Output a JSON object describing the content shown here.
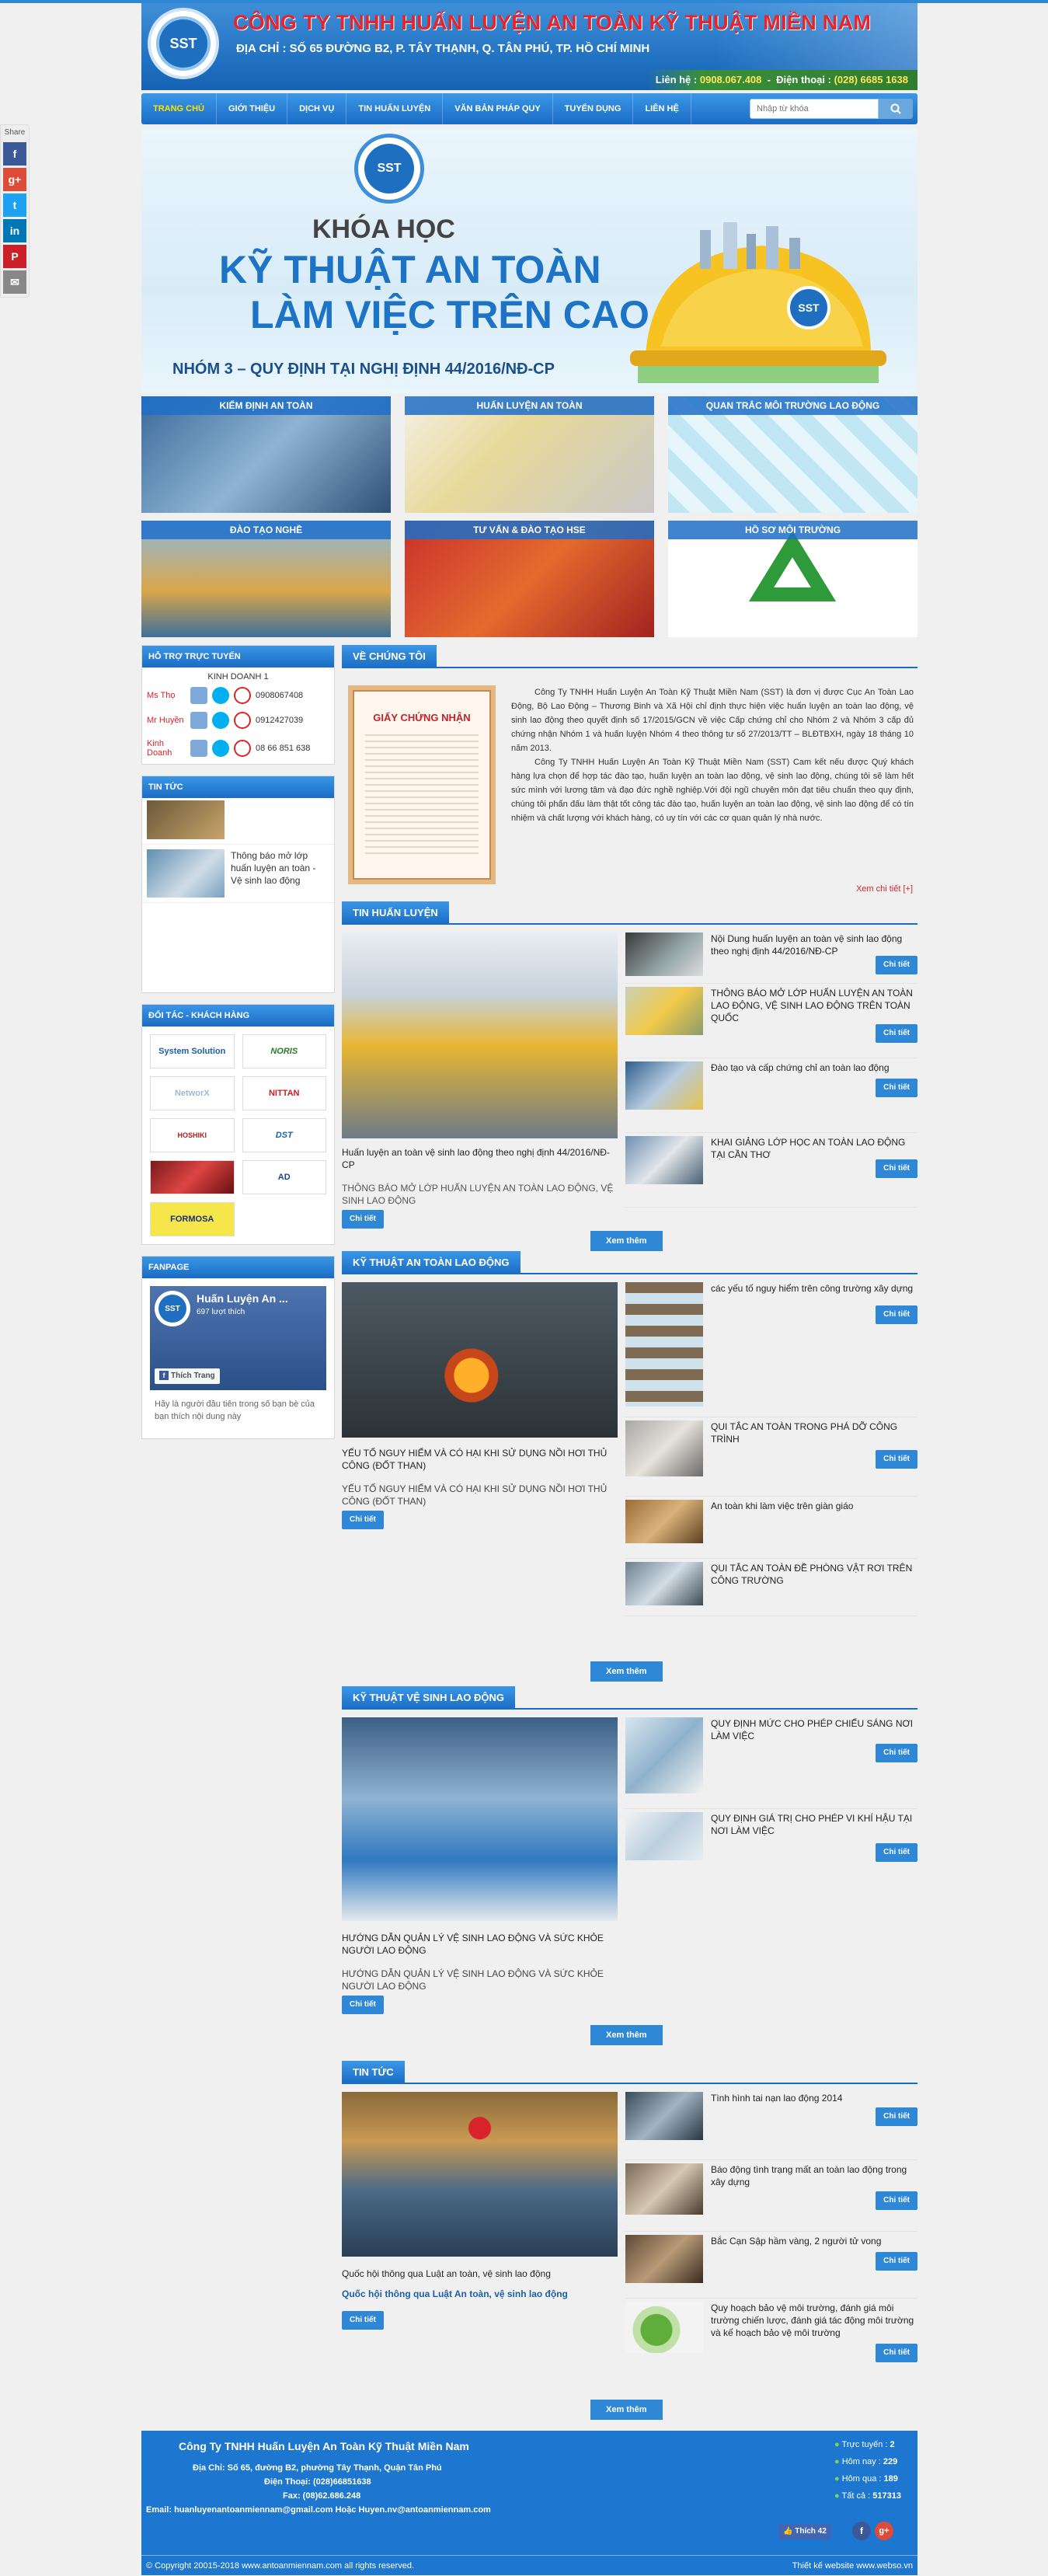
{
  "header": {
    "company": "CÔNG TY TNHH HUẤN LUYỆN AN TOÀN KỸ THUẬT MIỀN NAM",
    "address": "ĐỊA CHỈ : SỐ 65 ĐƯỜNG B2, P. TÂY THẠNH, Q. TÂN PHÚ, TP. HỒ CHÍ MINH",
    "contact_label": "Liên hệ :",
    "contact_phone": "0908.067.408",
    "hotline_label": "Điện thoại :",
    "hotline_phone": "(028) 6685 1638",
    "logo_text": "SST"
  },
  "nav": {
    "items": [
      "TRANG CHỦ",
      "GIỚI THIỆU",
      "DỊCH VỤ",
      "TIN HUẤN LUYỆN",
      "VĂN BẢN PHÁP QUY",
      "TUYỂN DỤNG",
      "LIÊN HỆ"
    ],
    "search_placeholder": "Nhập từ khóa"
  },
  "banner": {
    "logo_text": "SST",
    "line1": "KHÓA HỌC",
    "line2": "KỸ THUẬT AN TOÀN",
    "line3": "LÀM VIỆC TRÊN CAO",
    "line4": "NHÓM 3 – QUY ĐỊNH TẠI NGHỊ ĐỊNH 44/2016/NĐ-CP"
  },
  "tiles": [
    {
      "label": "KIỂM ĐỊNH AN TOÀN"
    },
    {
      "label": "HUẤN LUYỆN AN TOÀN"
    },
    {
      "label": "QUAN TRẮC MÔI TRƯỜNG LAO ĐỘNG"
    },
    {
      "label": "ĐÀO TẠO NGHỀ"
    },
    {
      "label": "TƯ VẤN & ĐÀO TẠO HSE"
    },
    {
      "label": "HỒ SƠ MÔI TRƯỜNG"
    }
  ],
  "support": {
    "title": "HỖ TRỢ TRỰC TUYẾN",
    "group": "KINH DOANH 1",
    "people": [
      {
        "name": "Ms Thọ",
        "phone": "0908067408"
      },
      {
        "name": "Mr Huyền",
        "phone": "0912427039"
      },
      {
        "name": "Kinh Doanh",
        "phone": "08 66 851 638"
      }
    ]
  },
  "left_news": {
    "title": "TIN TỨC",
    "items": [
      "Thông báo mở lớp huấn luyện an toàn - Vệ sinh lao động"
    ]
  },
  "partners": {
    "title": "ĐỐI TÁC - KHÁCH HÀNG",
    "logos": [
      "System Solution",
      "NORIS",
      "NetworX",
      "NITTAN",
      "HOSHIKI",
      "DST",
      "",
      "AD",
      "FORMOSA"
    ]
  },
  "fanpage": {
    "title": "FANPAGE",
    "page_name": "Huấn Luyện An ...",
    "likes": "697 lượt thích",
    "like_btn": "Thích Trang",
    "note": "Hãy là người đầu tiên trong số bạn bè của bạn thích nội dung này"
  },
  "about": {
    "title": "VỀ CHÚNG TÔI",
    "cert_title": "GIẤY CHỨNG NHẬN",
    "p1": "Công Ty TNHH Huấn Luyện An Toàn Kỹ Thuật Miền Nam (SST) là đơn vị được Cục An Toàn Lao Động, Bộ Lao Động – Thương Binh và Xã Hội chỉ định thực hiện việc huấn luyện an toàn lao động, vệ sinh lao động theo quyết định số 17/2015/GCN về việc Cấp chứng chỉ cho Nhóm 2 và Nhóm 3 cấp đủ chứng nhận Nhóm 1 và huấn luyện Nhóm 4 theo thông tư số 27/2013/TT – BLĐTBXH, ngày 18 tháng 10 năm 2013.",
    "p2": "Công Ty TNHH Huấn Luyện An Toàn Kỹ Thuật Miền Nam (SST) Cam kết nếu được Quý khách hàng lựa chọn để hợp tác đào tạo, huấn luyện an toàn lao động, vệ sinh lao động, chúng tôi sẽ làm hết sức mình với lương tâm và đạo đức nghề nghiệp.Với đội ngũ chuyên môn đạt tiêu chuẩn theo quy định, chúng tôi phấn đấu làm thật tốt công tác đào tạo, huấn luyện an toàn lao động, vệ sinh lao động để có tín nhiệm và chất lượng với khách hàng, có uy tín với các cơ quan quản lý nhà nước.",
    "more": "Xem chi tiết [+]"
  },
  "sections": [
    {
      "title": "TIN HUẤN LUYỆN",
      "feature_caption": "Huấn luyện an toàn vệ sinh lao động theo nghị định 44/2016/NĐ-CP",
      "feature_sub": "THÔNG BÁO MỞ LỚP HUẤN LUYỆN AN TOÀN LAO ĐỘNG, VỆ SINH LAO ĐỘNG",
      "items": [
        "Nội Dung huấn luyện an toàn vệ sinh lao động theo nghị định 44/2016/NĐ-CP",
        "THÔNG BÁO MỞ LỚP HUẤN LUYỆN AN TOÀN LAO ĐỘNG, VỆ SINH LAO ĐỘNG TRÊN TOÀN QUỐC",
        "Đào tạo và cấp chứng chỉ an toàn lao động",
        "KHAI GIẢNG LỚP HỌC AN TOÀN LAO ĐỘNG TẠI CẦN THƠ"
      ]
    },
    {
      "title": "KỸ THUẬT AN TOÀN LAO ĐỘNG",
      "feature_caption": "YẾU TỐ NGUY HIỂM VÀ CÓ HẠI KHI SỬ DỤNG NỒI HƠI THỦ CÔNG (ĐỐT THAN)",
      "feature_sub": "YẾU TỐ NGUY HIỂM VÀ CÓ HẠI KHI SỬ DỤNG NỒI HƠI THỦ CÔNG (ĐỐT THAN)",
      "items": [
        "các yếu tố nguy hiểm trên công trường xây dựng",
        "QUI TẮC AN TOÀN TRONG PHÁ DỠ CÔNG TRÌNH",
        "An toàn khi làm việc trên giàn giáo",
        "QUI TẮC AN TOÀN ĐỀ PHÒNG VẬT RƠI TRÊN CÔNG TRƯỜNG"
      ]
    },
    {
      "title": "KỸ THUẬT VỆ SINH LAO ĐỘNG",
      "feature_caption": "HƯỚNG DẪN QUẢN LÝ VỆ SINH LAO ĐỘNG VÀ SỨC KHỎE NGƯỜI LAO ĐỘNG",
      "feature_sub": "HƯỚNG DẪN QUẢN LÝ VỆ SINH LAO ĐỘNG VÀ SỨC KHỎE NGƯỜI LAO ĐỘNG",
      "items": [
        "QUY ĐỊNH MỨC CHO PHÉP CHIẾU SÁNG NƠI LÀM VIỆC",
        "QUY ĐỊNH GIÁ TRỊ CHO PHÉP VI KHÍ HẬU TẠI NƠI LÀM VIỆC"
      ]
    },
    {
      "title": "TIN TỨC",
      "feature_caption": "Quốc hội thông qua Luật an toàn, vệ sinh lao động",
      "feature_sub": "Quốc hội thông qua Luật An toàn, vệ sinh lao động",
      "items": [
        "Tình hình tai nạn lao động 2014",
        "Báo động tình trạng mất an toàn lao động trong xây dựng",
        "Bắc Cạn Sập hầm vàng, 2 người tử vong",
        "Quy hoạch bảo vệ môi trường, đánh giá môi trường chiến lược, đánh giá tác động môi trường và kế hoạch bảo vệ môi trường"
      ]
    }
  ],
  "labels": {
    "detail": "Chi tiết",
    "more": "Xem thêm",
    "share": "Share"
  },
  "footer": {
    "name": "Công Ty TNHH Huấn Luyện An Toàn Kỹ Thuật Miền Nam",
    "address": "Địa Chỉ: Số 65, đường B2, phường Tây Thạnh, Quận Tân Phú",
    "phone": "Điện Thoại: (028)66851638",
    "fax": "Fax: (08)62.686.248",
    "email": "Email: huanluyenantoanmiennam@gmail.com    Hoặc Huyen.nv@antoanmiennam.com",
    "fb_like": "Thích 42",
    "stats": [
      {
        "label": "Trực tuyến :",
        "value": "2"
      },
      {
        "label": "Hôm nay :",
        "value": "229"
      },
      {
        "label": "Hôm qua :",
        "value": "189"
      },
      {
        "label": "Tất cả :",
        "value": "517313"
      }
    ],
    "copyright": "© Copyright 20015-2018 www.antoanmiennam.com all rights reserved.",
    "designer": "Thiết kế website www.webso.vn"
  },
  "colors": {
    "brand": "#1d76cf",
    "accent_red": "#e8242b",
    "nav_active": "#ffe000"
  }
}
